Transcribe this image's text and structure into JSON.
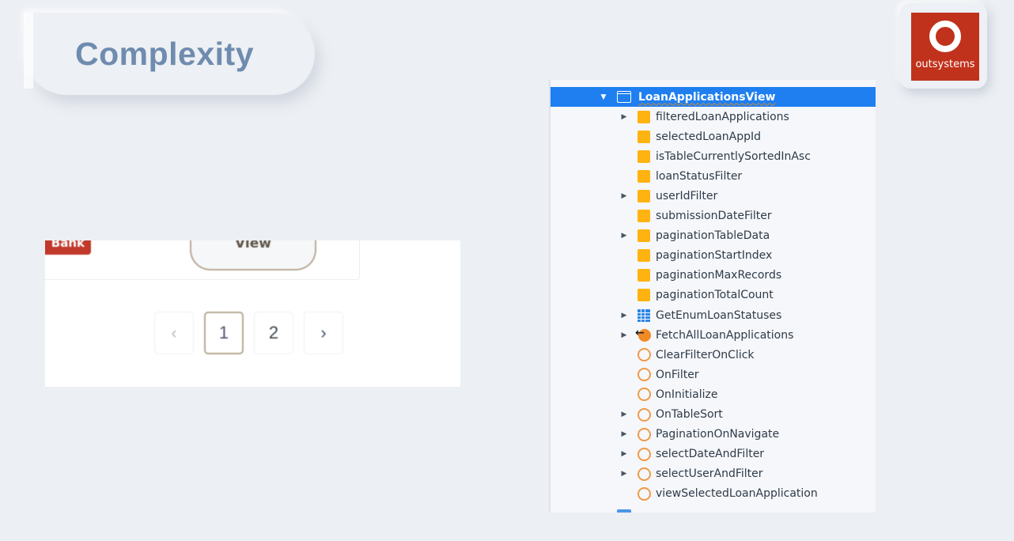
{
  "header": {
    "title": "Complexity"
  },
  "logo": {
    "name": "outsystems",
    "brand_color": "#c0321c"
  },
  "preview": {
    "badge_label": "Bank",
    "view_button_label": "View",
    "pagination": {
      "prev": "‹",
      "pages": [
        "1",
        "2"
      ],
      "current_page": "1",
      "next": "›"
    }
  },
  "tree": {
    "selection_color": "#1f7ff0",
    "root": {
      "label": "LoanApplicationsView",
      "icon": "screen-icon",
      "expanded": true
    },
    "items": [
      {
        "label": "filteredLoanApplications",
        "icon": "variable-icon",
        "expandable": true
      },
      {
        "label": "selectedLoanAppId",
        "icon": "variable-icon",
        "expandable": false
      },
      {
        "label": "isTableCurrentlySortedInAsc",
        "icon": "variable-icon",
        "expandable": false
      },
      {
        "label": "loanStatusFilter",
        "icon": "variable-icon",
        "expandable": false
      },
      {
        "label": "userIdFilter",
        "icon": "variable-icon",
        "expandable": true
      },
      {
        "label": "submissionDateFilter",
        "icon": "variable-icon",
        "expandable": false
      },
      {
        "label": "paginationTableData",
        "icon": "variable-icon",
        "expandable": true
      },
      {
        "label": "paginationStartIndex",
        "icon": "variable-icon",
        "expandable": false
      },
      {
        "label": "paginationMaxRecords",
        "icon": "variable-icon",
        "expandable": false
      },
      {
        "label": "paginationTotalCount",
        "icon": "variable-icon",
        "expandable": false
      },
      {
        "label": "GetEnumLoanStatuses",
        "icon": "aggregate-icon",
        "expandable": true
      },
      {
        "label": "FetchAllLoanApplications",
        "icon": "data-action-icon",
        "expandable": true
      },
      {
        "label": "ClearFilterOnClick",
        "icon": "client-action-icon",
        "expandable": false
      },
      {
        "label": "OnFilter",
        "icon": "client-action-icon",
        "expandable": false
      },
      {
        "label": "OnInitialize",
        "icon": "client-action-icon",
        "expandable": false
      },
      {
        "label": "OnTableSort",
        "icon": "client-action-icon",
        "expandable": true
      },
      {
        "label": "PaginationOnNavigate",
        "icon": "client-action-icon",
        "expandable": true
      },
      {
        "label": "selectDateAndFilter",
        "icon": "client-action-icon",
        "expandable": true
      },
      {
        "label": "selectUserAndFilter",
        "icon": "client-action-icon",
        "expandable": true
      },
      {
        "label": "viewSelectedLoanApplication",
        "icon": "client-action-icon",
        "expandable": false
      }
    ]
  }
}
